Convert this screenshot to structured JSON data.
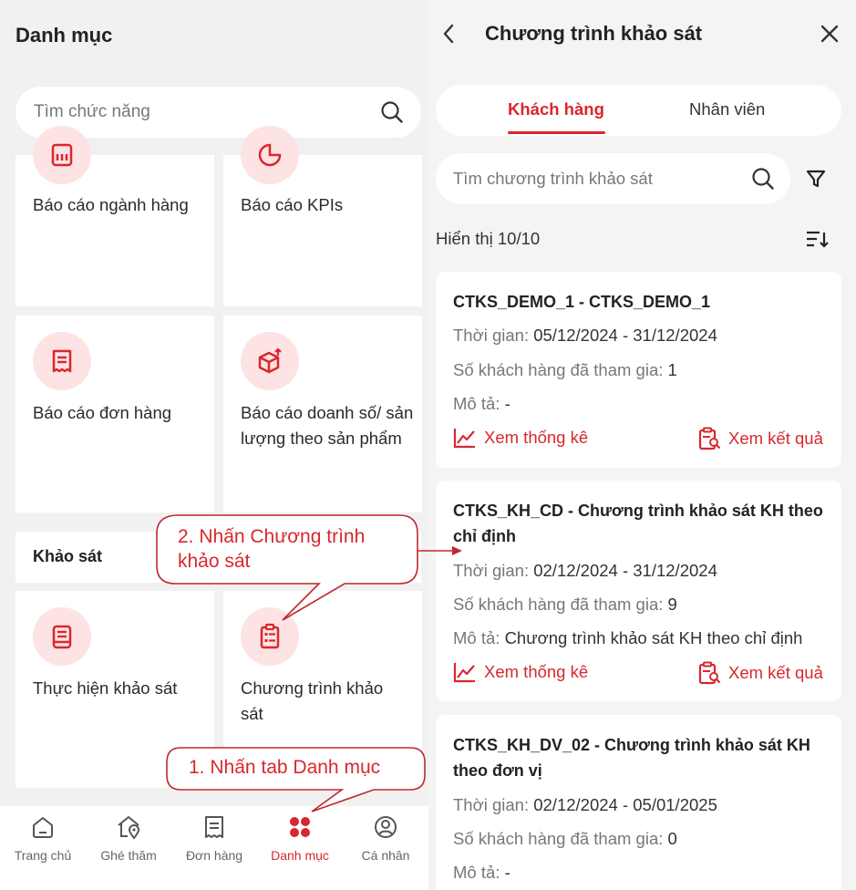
{
  "left": {
    "title": "Danh mục",
    "search_placeholder": "Tìm chức năng",
    "tiles": {
      "bao_cao_nganh_hang": "Báo cáo ngành hàng",
      "bao_cao_kpis": "Báo cáo KPIs",
      "bao_cao_don_hang": "Báo cáo đơn hàng",
      "bao_cao_doanh_so": "Báo cáo doanh số/ sản lượng theo sản phẩm",
      "thuc_hien_khao_sat": "Thực hiện khảo sát",
      "chuong_trinh_khao_sat": "Chương trình khảo sát"
    },
    "section_khao_sat": "Khảo sát"
  },
  "bottom_nav": [
    {
      "label": "Trang chủ",
      "icon": "home-icon",
      "active": false
    },
    {
      "label": "Ghé thăm",
      "icon": "visit-location-icon",
      "active": false
    },
    {
      "label": "Đơn hàng",
      "icon": "order-receipt-icon",
      "active": false
    },
    {
      "label": "Danh mục",
      "icon": "grid-menu-icon",
      "active": true
    },
    {
      "label": "Cá nhân",
      "icon": "user-profile-icon",
      "active": false
    }
  ],
  "right": {
    "title": "Chương trình khảo sát",
    "tabs": {
      "customer": "Khách hàng",
      "employee": "Nhân viên"
    },
    "search_placeholder": "Tìm chương trình khảo sát",
    "count_label": "Hiển thị 10/10",
    "cards": [
      {
        "title": "CTKS_DEMO_1 - CTKS_DEMO_1",
        "time_label": "Thời gian:",
        "time_value": "05/12/2024 - 31/12/2024",
        "customers_label": "Số khách hàng đã tham gia:",
        "customers_value": "1",
        "desc_label": "Mô tả:",
        "desc_value": "-",
        "stats_label": "Xem thống kê",
        "result_label": "Xem kết quả"
      },
      {
        "title": "CTKS_KH_CD - Chương trình khảo sát KH theo chỉ định",
        "time_label": "Thời gian:",
        "time_value": "02/12/2024 - 31/12/2024",
        "customers_label": "Số khách hàng đã tham gia:",
        "customers_value": "9",
        "desc_label": "Mô tả:",
        "desc_value": "Chương trình khảo sát KH theo chỉ định",
        "stats_label": "Xem thống kê",
        "result_label": "Xem kết quả"
      },
      {
        "title": "CTKS_KH_DV_02 - Chương trình khảo sát KH theo đơn vị",
        "time_label": "Thời gian:",
        "time_value": "02/12/2024 - 05/01/2025",
        "customers_label": "Số khách hàng đã tham gia:",
        "customers_value": "0",
        "desc_label": "Mô tả:",
        "desc_value": "-"
      }
    ]
  },
  "annotations": {
    "step1": "1. Nhấn tab Danh mục",
    "step2_line1": "2. Nhấn Chương trình",
    "step2_line2": "khảo sát"
  },
  "colors": {
    "accent": "#d9272e",
    "icon_bg": "#fde3e3",
    "panel_bg": "#f1f1f1"
  }
}
